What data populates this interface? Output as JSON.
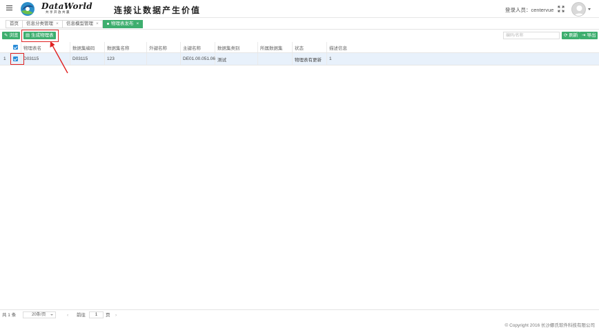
{
  "header": {
    "brand_name": "DataWorld",
    "brand_sub": "共享开放共赢",
    "slogan": "连接让数据产生价值",
    "user_label": "登录人员：centervue"
  },
  "tabs": [
    {
      "label": "首页"
    },
    {
      "label": "信息分类管理"
    },
    {
      "label": "信息模型管理"
    },
    {
      "label": "物理表发布"
    }
  ],
  "toolbar": {
    "browse_label": "浏览",
    "generate_label": "生成物理表",
    "search_placeholder": "编码/名称",
    "refresh_label": "刷新",
    "export_label": "导出"
  },
  "table": {
    "columns": [
      "物理表名",
      "数据集编码",
      "数据集名称",
      "外键名称",
      "主键名称",
      "数据集类别",
      "所属数据集",
      "状态",
      "描述信息"
    ],
    "rows": [
      {
        "index": "1",
        "cells": [
          "D03115",
          "D03115",
          "123",
          "",
          "DE01.00.051.06",
          "测试",
          "",
          "物理表有更新",
          "1"
        ]
      }
    ]
  },
  "pagination": {
    "total": "共 1 条",
    "page_size": "20条/页",
    "goto_label": "前往",
    "page_value": "1",
    "page_unit": "页"
  },
  "copyright": "© Copyright 2016 长沙娜氏软件科技有限公司",
  "colors": {
    "accent": "#3dae6e",
    "selected_row": "#e8f1fb",
    "annotation": "#e02020",
    "checkbox": "#2a8cd8"
  }
}
